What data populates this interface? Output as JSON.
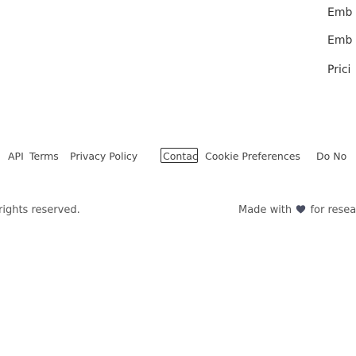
{
  "top_links": [
    "Emb",
    "Emb",
    "Prici"
  ],
  "footer": {
    "links": {
      "api": "API",
      "terms": "Terms",
      "privacy": "Privacy Policy",
      "contact": "Contact",
      "cookies": "Cookie Preferences",
      "do_not_sell": "Do No"
    },
    "copyright": "rights reserved.",
    "made_with_prefix": "Made with",
    "made_with_suffix": "for research",
    "heart_icon": "heart-icon"
  }
}
